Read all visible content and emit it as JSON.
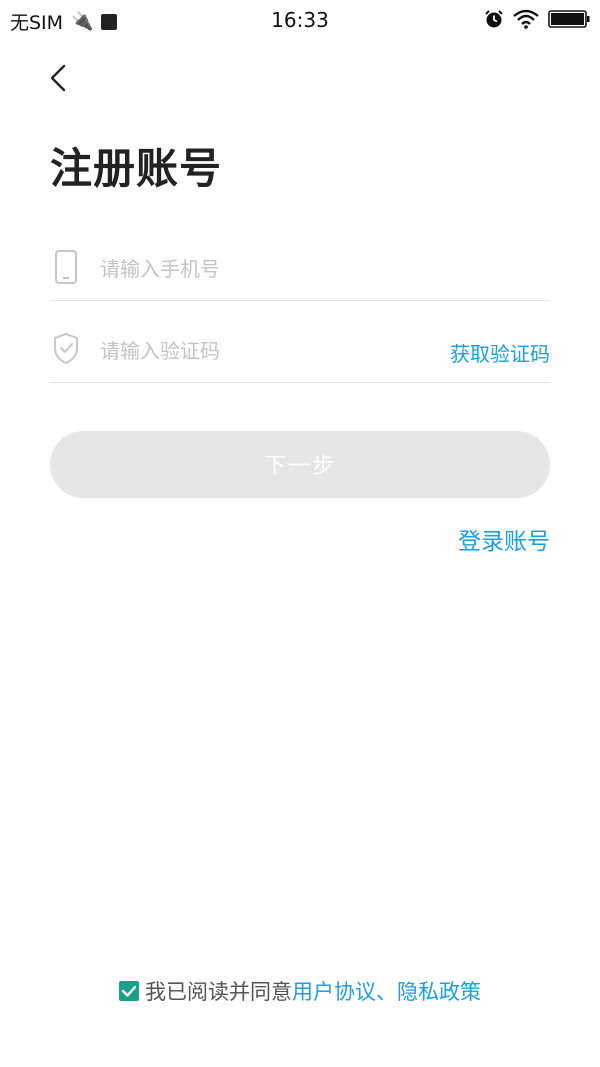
{
  "status_bar": {
    "carrier": "无SIM",
    "time": "16:33"
  },
  "page": {
    "title": "注册账号"
  },
  "phone": {
    "placeholder": "请输入手机号",
    "icon": "phone-icon"
  },
  "code": {
    "placeholder": "请输入验证码",
    "icon": "shield-check-icon",
    "get_code_label": "获取验证码"
  },
  "next_button": {
    "label": "下一步"
  },
  "login_link": {
    "label": "登录账号"
  },
  "agreement": {
    "checked": true,
    "text": "我已阅读并同意",
    "user_agreement": "用户协议",
    "separator": "、",
    "privacy_policy": "隐私政策"
  },
  "colors": {
    "accent": "#1a9fe3",
    "checkbox": "#1b9e8a",
    "button_disabled": "#e6e6e6"
  }
}
